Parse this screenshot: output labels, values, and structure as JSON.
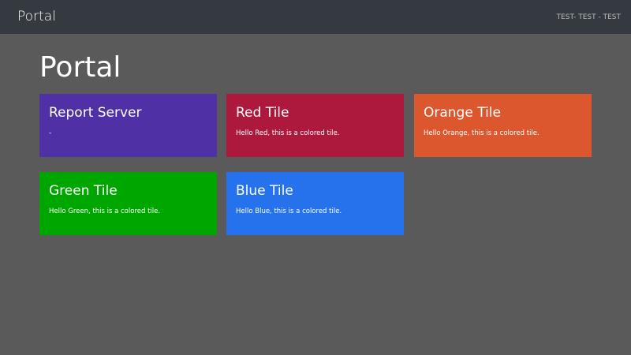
{
  "navbar": {
    "brand": "Portal",
    "user": "TEST- TEST - TEST"
  },
  "page": {
    "title": "Portal"
  },
  "tiles": [
    {
      "title": "Report Server",
      "text": "-",
      "color": "#4f31a5"
    },
    {
      "title": "Red Tile",
      "text": "Hello Red, this is a colored tile.",
      "color": "#ac193d"
    },
    {
      "title": "Orange Tile",
      "text": "Hello Orange, this is a colored tile.",
      "color": "#dc572e"
    },
    {
      "title": "Green Tile",
      "text": "Hello Green, this is a colored tile.",
      "color": "#00a600"
    },
    {
      "title": "Blue Tile",
      "text": "Hello Blue, this is a colored tile.",
      "color": "#2672ec"
    }
  ]
}
